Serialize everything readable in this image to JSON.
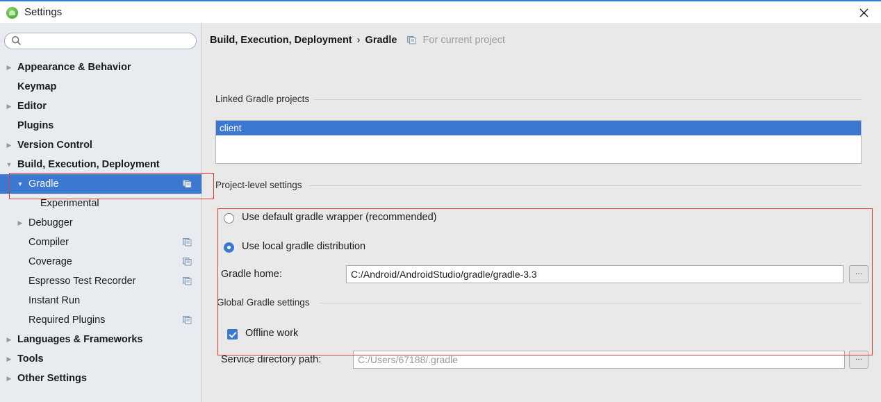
{
  "window": {
    "title": "Settings",
    "app_icon": "android-studio-icon",
    "close_icon": "close-icon"
  },
  "sidebar": {
    "search": {
      "value": "",
      "placeholder": "",
      "icon": "search-icon"
    },
    "items": [
      {
        "label": "Appearance & Behavior",
        "level": 0,
        "twisty": "collapsed",
        "selected": false,
        "scope_icon": false
      },
      {
        "label": "Keymap",
        "level": 0,
        "twisty": "none",
        "selected": false,
        "scope_icon": false
      },
      {
        "label": "Editor",
        "level": 0,
        "twisty": "collapsed",
        "selected": false,
        "scope_icon": false
      },
      {
        "label": "Plugins",
        "level": 0,
        "twisty": "none",
        "selected": false,
        "scope_icon": false
      },
      {
        "label": "Version Control",
        "level": 0,
        "twisty": "collapsed",
        "selected": false,
        "scope_icon": false
      },
      {
        "label": "Build, Execution, Deployment",
        "level": 0,
        "twisty": "expanded",
        "selected": false,
        "scope_icon": false
      },
      {
        "label": "Gradle",
        "level": 1,
        "twisty": "expanded",
        "selected": true,
        "scope_icon": true
      },
      {
        "label": "Experimental",
        "level": 2,
        "twisty": "none",
        "selected": false,
        "scope_icon": false
      },
      {
        "label": "Debugger",
        "level": 1,
        "twisty": "collapsed",
        "selected": false,
        "scope_icon": false
      },
      {
        "label": "Compiler",
        "level": 1,
        "twisty": "none",
        "selected": false,
        "scope_icon": true
      },
      {
        "label": "Coverage",
        "level": 1,
        "twisty": "none",
        "selected": false,
        "scope_icon": true
      },
      {
        "label": "Espresso Test Recorder",
        "level": 1,
        "twisty": "none",
        "selected": false,
        "scope_icon": true
      },
      {
        "label": "Instant Run",
        "level": 1,
        "twisty": "none",
        "selected": false,
        "scope_icon": false
      },
      {
        "label": "Required Plugins",
        "level": 1,
        "twisty": "none",
        "selected": false,
        "scope_icon": true
      },
      {
        "label": "Languages & Frameworks",
        "level": 0,
        "twisty": "collapsed",
        "selected": false,
        "scope_icon": false
      },
      {
        "label": "Tools",
        "level": 0,
        "twisty": "collapsed",
        "selected": false,
        "scope_icon": false
      },
      {
        "label": "Other Settings",
        "level": 0,
        "twisty": "collapsed",
        "selected": false,
        "scope_icon": false
      }
    ]
  },
  "main": {
    "breadcrumb": {
      "parent": "Build, Execution, Deployment",
      "separator": "›",
      "current": "Gradle",
      "scope_icon": "project-scope-icon",
      "note": "For current project"
    },
    "linked_projects": {
      "group_label": "Linked Gradle projects",
      "rows": [
        {
          "label": "client",
          "selected": true
        }
      ]
    },
    "project_level": {
      "group_label": "Project-level settings",
      "radios": [
        {
          "label": "Use default gradle wrapper (recommended)",
          "selected": false
        },
        {
          "label": "Use local gradle distribution",
          "selected": true
        }
      ],
      "gradle_home": {
        "label": "Gradle home:",
        "value": "C:/Android/AndroidStudio/gradle/gradle-3.3",
        "placeholder": "",
        "browse_label": "..."
      }
    },
    "global_settings": {
      "group_label": "Global Gradle settings",
      "offline_work": {
        "label": "Offline work",
        "checked": true
      },
      "service_dir": {
        "label": "Service directory path:",
        "value": "",
        "placeholder": "C:/Users/67188/.gradle",
        "browse_label": "..."
      }
    }
  },
  "annotations": {
    "color": "#e23b32",
    "boxes": [
      {
        "name": "gradle-sidebar-highlight"
      },
      {
        "name": "local-distribution-highlight"
      }
    ]
  },
  "colors": {
    "accent_blue": "#3a78d2",
    "sidebar_bg": "#e8ecf0",
    "panel_bg": "#e9e9e9",
    "titlebar_accent": "#2f7fd1"
  }
}
